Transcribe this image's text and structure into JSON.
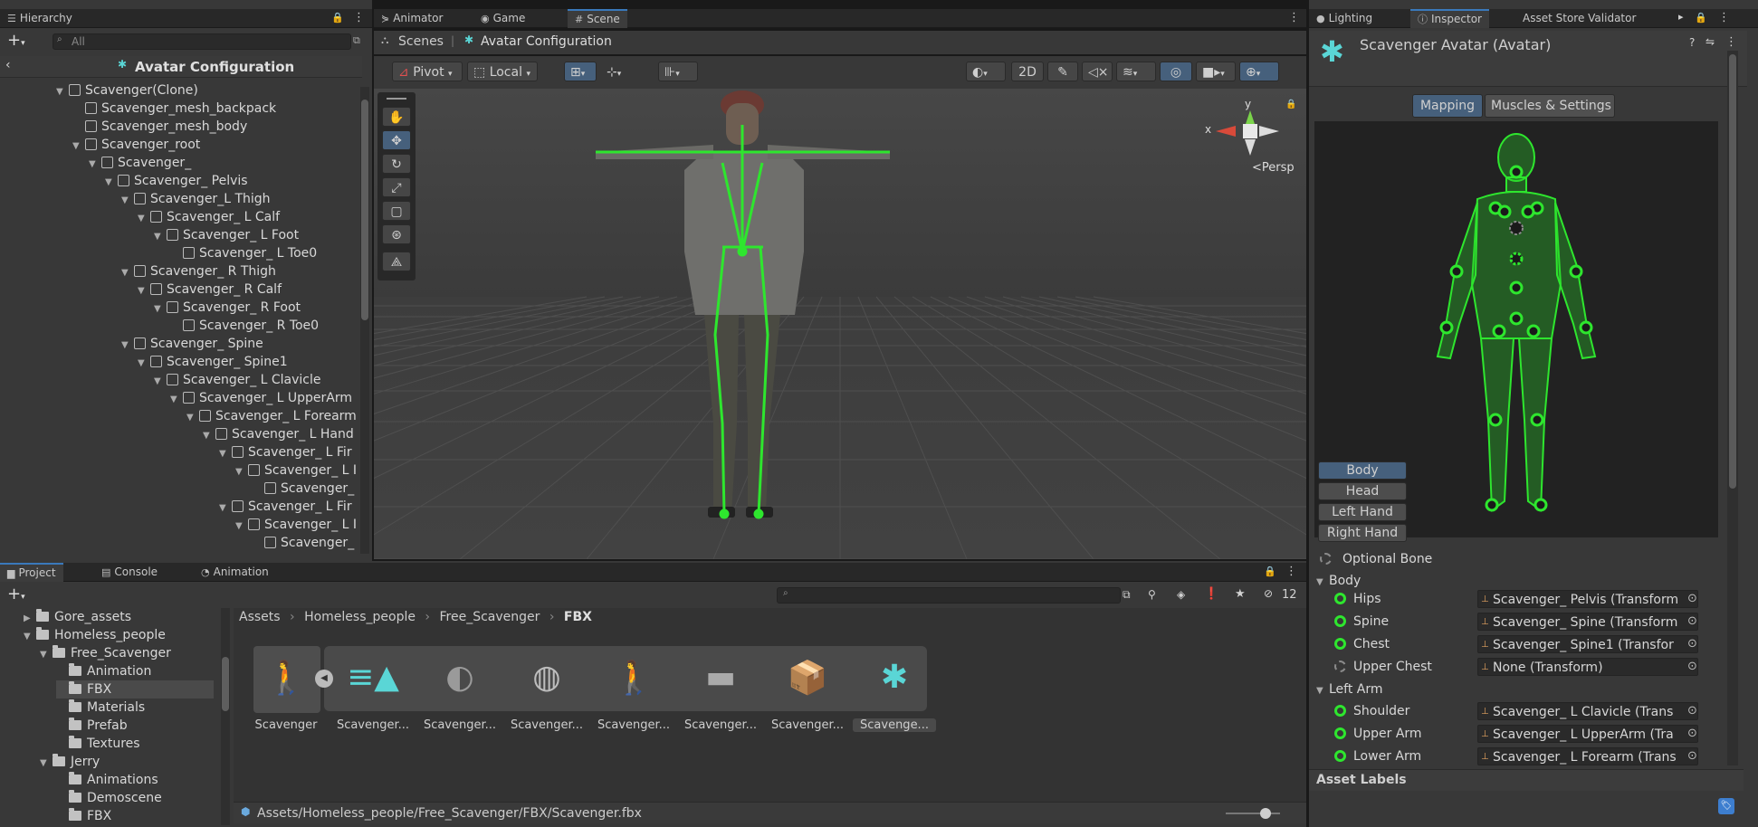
{
  "hierarchy": {
    "tab": "Hierarchy",
    "search_placeholder": "All",
    "scene_title": "Avatar Configuration",
    "items": [
      {
        "label": "Scavenger(Clone)"
      },
      {
        "label": "Scavenger_mesh_backpack"
      },
      {
        "label": "Scavenger_mesh_body"
      },
      {
        "label": "Scavenger_root"
      },
      {
        "label": "Scavenger_"
      },
      {
        "label": "Scavenger_ Pelvis"
      },
      {
        "label": "Scavenger_L Thigh"
      },
      {
        "label": "Scavenger_ L Calf"
      },
      {
        "label": "Scavenger_ L Foot"
      },
      {
        "label": "Scavenger_ L Toe0"
      },
      {
        "label": "Scavenger_ R Thigh"
      },
      {
        "label": "Scavenger_ R Calf"
      },
      {
        "label": "Scavenger_ R Foot"
      },
      {
        "label": "Scavenger_ R Toe0"
      },
      {
        "label": "Scavenger_ Spine"
      },
      {
        "label": "Scavenger_ Spine1"
      },
      {
        "label": "Scavenger_ L Clavicle"
      },
      {
        "label": "Scavenger_ L UpperArm"
      },
      {
        "label": "Scavenger_ L Forearm"
      },
      {
        "label": "Scavenger_ L Hand"
      },
      {
        "label": "Scavenger_ L Fir"
      },
      {
        "label": "Scavenger_ L I"
      },
      {
        "label": "Scavenger_"
      },
      {
        "label": "Scavenger_ L Fir"
      },
      {
        "label": "Scavenger_ L I"
      },
      {
        "label": "Scavenger_"
      }
    ]
  },
  "scene_tabs": {
    "animator": "Animator",
    "game": "Game",
    "scene": "Scene"
  },
  "scene": {
    "breadcrumb_root": "Scenes",
    "breadcrumb_current": "Avatar Configuration",
    "pivot": "Pivot",
    "local": "Local",
    "mode_2d": "2D",
    "persp": "Persp",
    "axis_x": "x",
    "axis_y": "y"
  },
  "inspector_tabs": {
    "lighting": "Lighting",
    "inspector": "Inspector",
    "asset_store": "Asset Store Validator"
  },
  "inspector": {
    "title": "Scavenger Avatar (Avatar)",
    "tab_mapping": "Mapping",
    "tab_muscles": "Muscles & Settings",
    "body_buttons": [
      "Body",
      "Head",
      "Left Hand",
      "Right Hand"
    ],
    "optional_bone": "Optional Bone",
    "section_body": "Body",
    "section_left_arm": "Left Arm",
    "bones": [
      {
        "label": "Hips",
        "value": "Scavenger_ Pelvis (Transform"
      },
      {
        "label": "Spine",
        "value": "Scavenger_ Spine (Transform"
      },
      {
        "label": "Chest",
        "value": "Scavenger_ Spine1 (Transfor"
      },
      {
        "label": "Upper Chest",
        "value": "None (Transform)"
      },
      {
        "label": "Shoulder",
        "value": "Scavenger_ L Clavicle (Trans"
      },
      {
        "label": "Upper Arm",
        "value": "Scavenger_ L UpperArm (Tra"
      },
      {
        "label": "Lower Arm",
        "value": "Scavenger_ L Forearm (Trans"
      }
    ],
    "asset_labels": "Asset Labels"
  },
  "project_tabs": {
    "project": "Project",
    "console": "Console",
    "animation": "Animation"
  },
  "project": {
    "hidden_count": "12",
    "folders": [
      {
        "label": "Gore_assets"
      },
      {
        "label": "Homeless_people"
      },
      {
        "label": "Free_Scavenger"
      },
      {
        "label": "Animation"
      },
      {
        "label": "FBX"
      },
      {
        "label": "Materials"
      },
      {
        "label": "Prefab"
      },
      {
        "label": "Textures"
      },
      {
        "label": "Jerry"
      },
      {
        "label": "Animations"
      },
      {
        "label": "Demoscene"
      },
      {
        "label": "FBX"
      }
    ],
    "breadcrumb": [
      "Assets",
      "Homeless_people",
      "Free_Scavenger",
      "FBX"
    ],
    "assets": [
      {
        "label": "Scavenger"
      },
      {
        "label": "Scavenger..."
      },
      {
        "label": "Scavenger..."
      },
      {
        "label": "Scavenger..."
      },
      {
        "label": "Scavenger..."
      },
      {
        "label": "Scavenger..."
      },
      {
        "label": "Scavenger..."
      },
      {
        "label": "Scavenge..."
      }
    ],
    "status_path": "Assets/Homeless_people/Free_Scavenger/FBX/Scavenger.fbx"
  }
}
